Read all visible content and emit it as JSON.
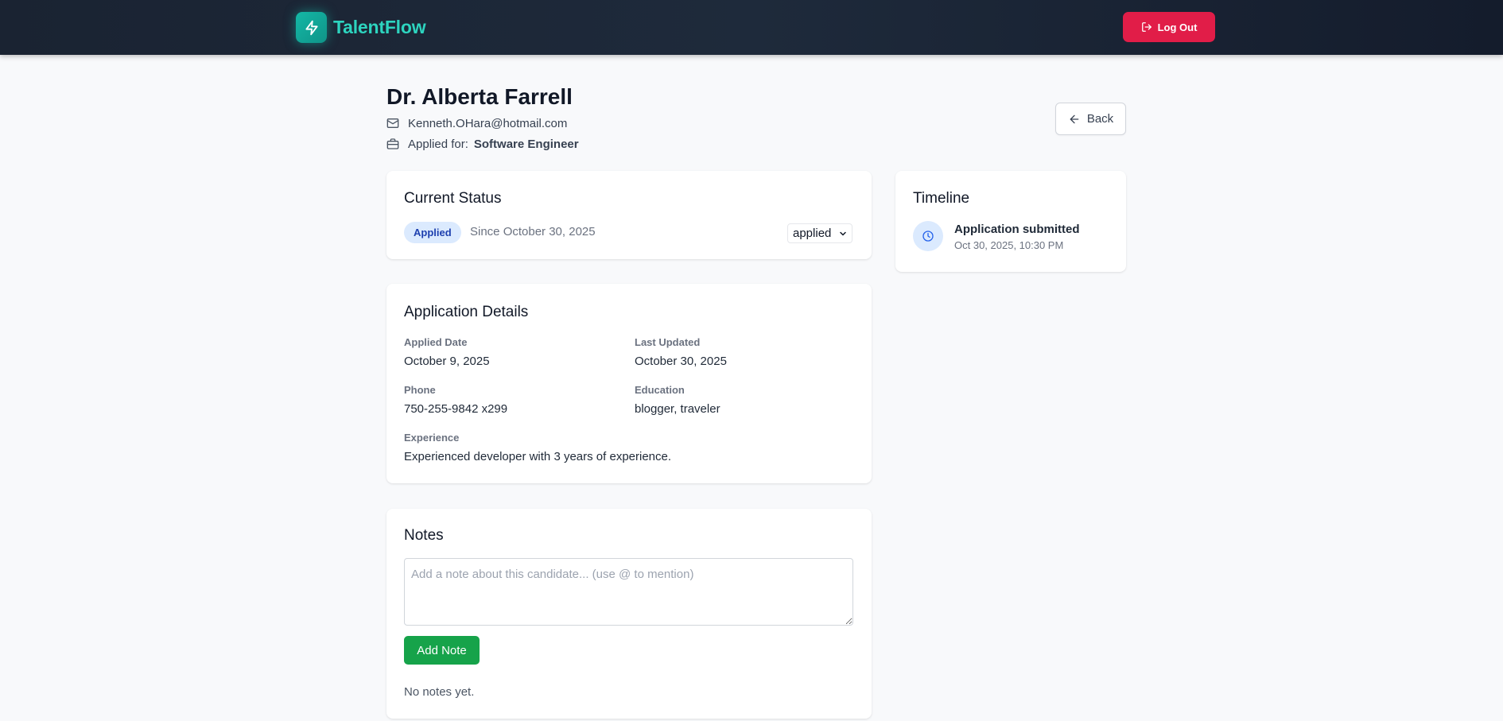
{
  "nav": {
    "brand": "TalentFlow",
    "logout_label": "Log Out"
  },
  "candidate": {
    "name": "Dr. Alberta Farrell",
    "email": "Kenneth.OHara@hotmail.com",
    "applied_for_label": "Applied for:",
    "position": "Software Engineer",
    "back_label": "Back"
  },
  "status": {
    "title": "Current Status",
    "badge": "Applied",
    "since": "Since October 30, 2025",
    "select_value": "applied"
  },
  "details": {
    "title": "Application Details",
    "applied_date_label": "Applied Date",
    "applied_date": "October 9, 2025",
    "last_updated_label": "Last Updated",
    "last_updated": "October 30, 2025",
    "phone_label": "Phone",
    "phone": "750-255-9842 x299",
    "education_label": "Education",
    "education": "blogger, traveler",
    "experience_label": "Experience",
    "experience": "Experienced developer with 3 years of experience."
  },
  "notes": {
    "title": "Notes",
    "placeholder": "Add a note about this candidate... (use @ to mention)",
    "add_label": "Add Note",
    "empty_text": "No notes yet."
  },
  "timeline": {
    "title": "Timeline",
    "events": [
      {
        "title": "Application submitted",
        "date": "Oct 30, 2025, 10:30 PM"
      }
    ]
  },
  "colors": {
    "brand": "#2dd4bf",
    "logout": "#e11d48",
    "badge_bg": "#dbeafe",
    "badge_text": "#1e40af",
    "add_note": "#16a34a"
  }
}
